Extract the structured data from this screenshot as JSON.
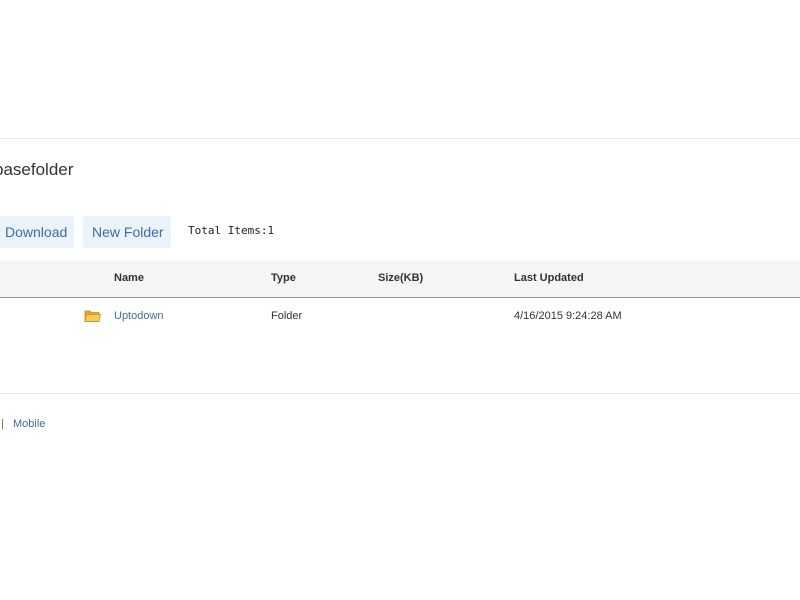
{
  "page": {
    "title": "basefolder"
  },
  "toolbar": {
    "download_label": "Download",
    "new_folder_label": "New Folder",
    "total_items_label": "Total Items:",
    "total_items_count": "1"
  },
  "table": {
    "columns": [
      "Name",
      "Type",
      "Size(KB)",
      "Last Updated"
    ],
    "rows": [
      {
        "icon": "folder-icon",
        "name": "Uptodown",
        "type": "Folder",
        "size": "",
        "last_updated": "4/16/2015 9:24:28 AM"
      }
    ]
  },
  "footer": {
    "separator": "|",
    "mobile_link": "Mobile"
  },
  "colors": {
    "link": "#3a6ea5",
    "button_bg": "#eaf3fa",
    "header_bg": "#f5f5f5",
    "folder_icon": "#f2c14e"
  }
}
